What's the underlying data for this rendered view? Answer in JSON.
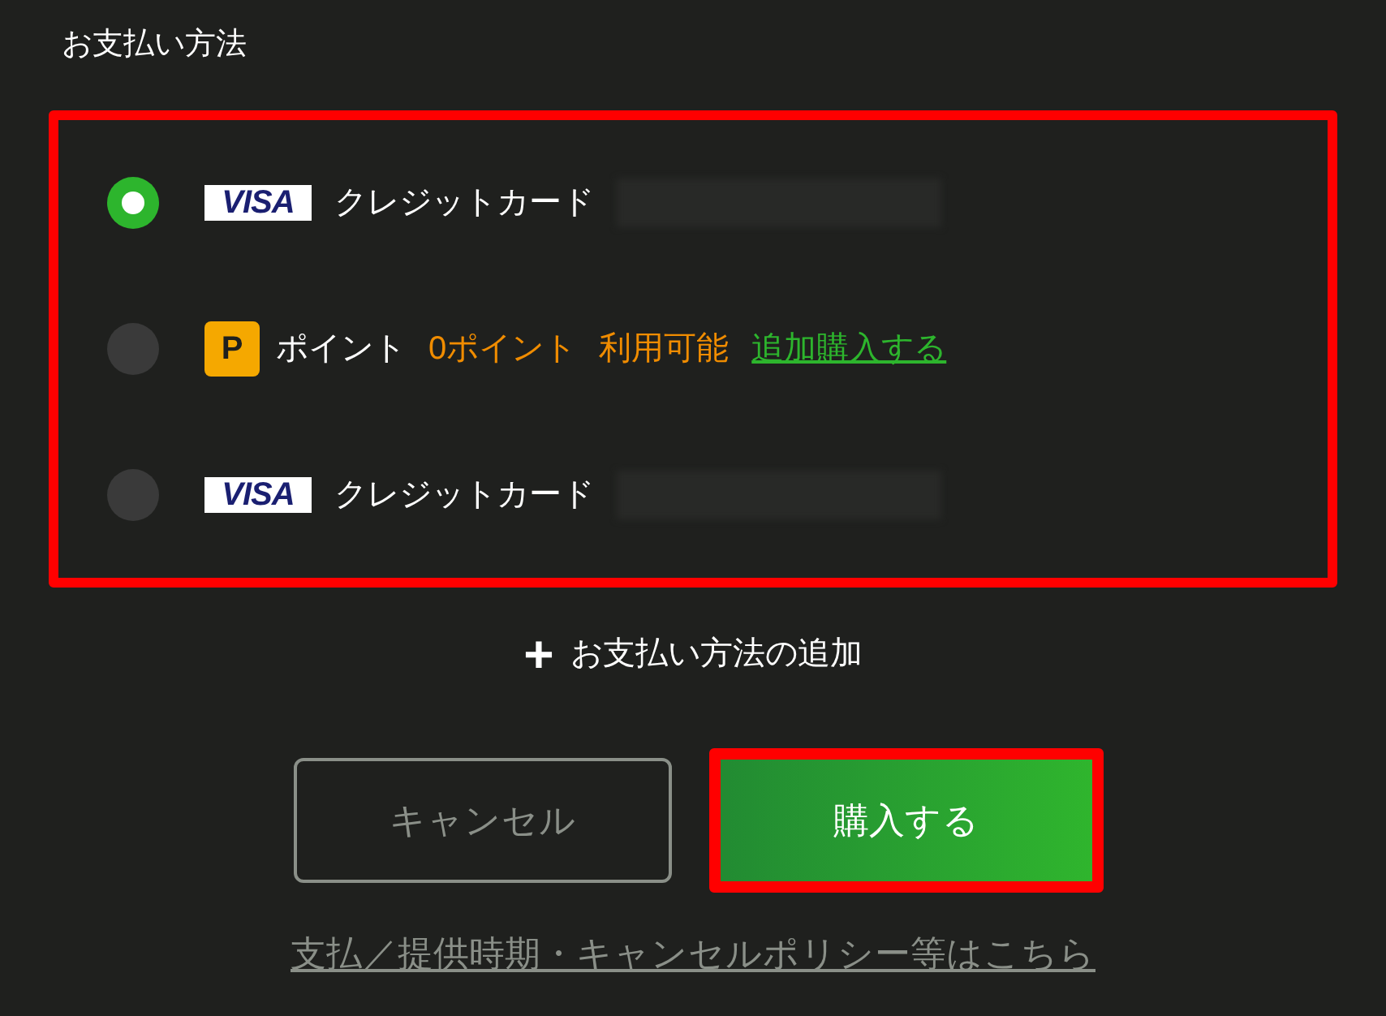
{
  "heading": "お支払い方法",
  "methods_panel": {
    "highlighted": true
  },
  "methods": [
    {
      "kind": "card",
      "selected": true,
      "logo_text": "VISA",
      "label": "クレジットカード"
    },
    {
      "kind": "points",
      "selected": false,
      "logo_text": "P",
      "label": "ポイント",
      "balance": "0ポイント",
      "availability": "利用可能",
      "link": "追加購入する"
    },
    {
      "kind": "card",
      "selected": false,
      "logo_text": "VISA",
      "label": "クレジットカード"
    }
  ],
  "add_method": {
    "icon": "+",
    "label": "お支払い方法の追加"
  },
  "buttons": [
    {
      "kind": "secondary",
      "label": "キャンセル",
      "highlighted": false
    },
    {
      "kind": "primary",
      "label": "購入する",
      "highlighted": true
    }
  ],
  "policy_link": "支払／提供時期・キャンセルポリシー等はこちら"
}
